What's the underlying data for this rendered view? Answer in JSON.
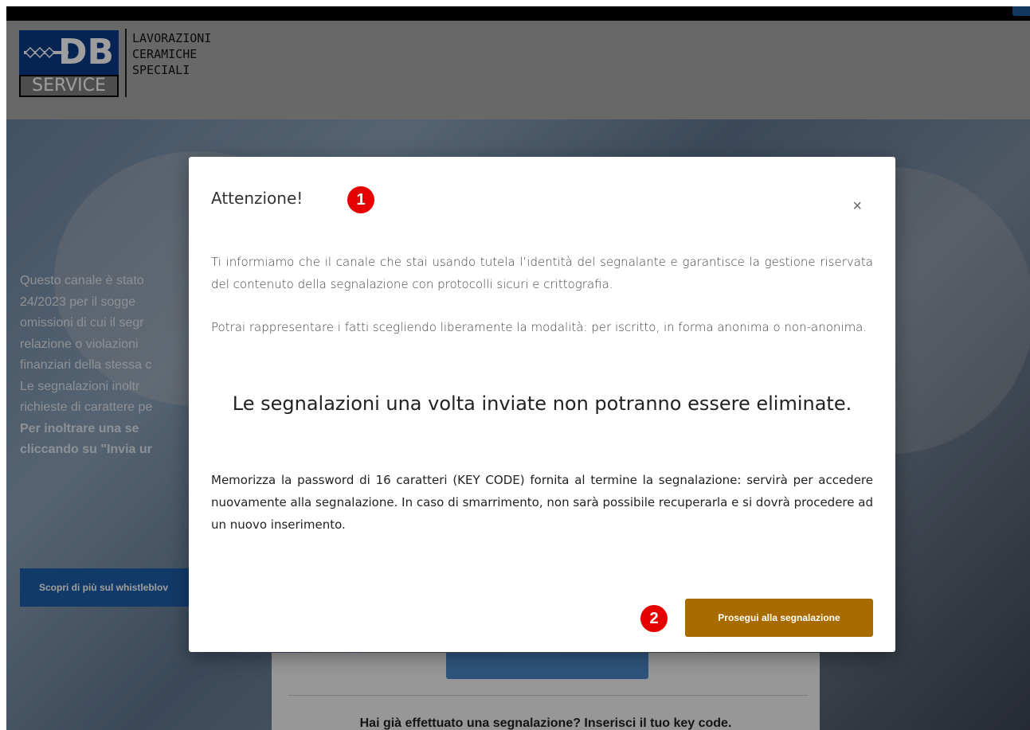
{
  "header": {
    "logo_db": "DB",
    "logo_service": "SERVICE",
    "tagline": [
      "LAVORAZIONI",
      "CERAMICHE",
      "SPECIALI"
    ]
  },
  "hero": {
    "text_lines": [
      "Questo canale è stato",
      "24/2023 per il sogge",
      "omissioni di cui il segr",
      "relazione o violazioni",
      "finanziari della stessa c",
      "Le segnalazioni inoltr",
      "richieste di carattere pe"
    ],
    "bold_lines": [
      "Per inoltrare una se",
      "cliccando su \"Invia ur"
    ],
    "learn_more_button": "Scopri di più sul whistleblov"
  },
  "card": {
    "existing_report_text": "Hai già effettuato una segnalazione? Inserisci il tuo key code."
  },
  "modal": {
    "title": "Attenzione!",
    "close_symbol": "×",
    "paragraph1": "Ti informiamo che il canale che stai usando tutela l’identità del segnalante e garantisce la gestione riservata del contenuto della segnalazione con protocolli sicuri e crittografia.",
    "paragraph2": "Potrai rappresentare i fatti scegliendo liberamente la modalità: per iscritto, in forma anonima o non-anonima.",
    "warning": "Le segnalazioni una volta inviate non potranno essere eliminate.",
    "note": "Memorizza la password di 16 caratteri (KEY CODE) fornita al termine la segnalazione: servirà per accedere nuovamente alla segnalazione. In caso di smarrimento, non sarà possibile recuperarla e si dovrà procedere ad un nuovo inserimento.",
    "action_button": "Prosegui alla segnalazione"
  },
  "markers": [
    "1",
    "2"
  ],
  "colors": {
    "action_button": "#a86b00",
    "hero_button": "#1d5ea8",
    "marker": "#e60000",
    "header_bg": "#a9a9a9"
  }
}
